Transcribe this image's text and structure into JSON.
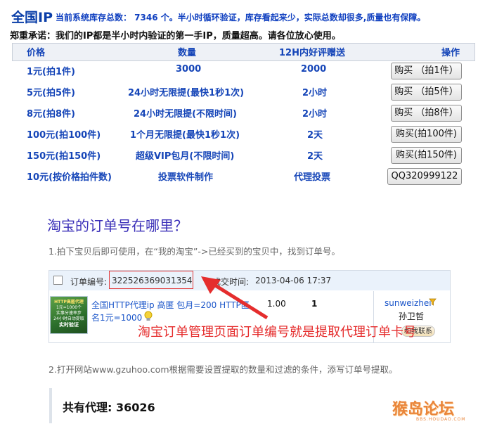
{
  "header": {
    "brand": "全国IP",
    "stock_text": "当前系统库存总数： 7346 个。半小时循环验证，库存看起来少，实际总数却很多,质量也有保障。",
    "promise": "郑重承诺：我们的IP都是半小时内验证的第一手IP，质量超高。请各位放心使用。"
  },
  "price_table": {
    "headers": [
      "价格",
      "数量",
      "12H内好评赠送",
      "操作"
    ],
    "rows": [
      {
        "price": "1元(拍1件)",
        "quantity": "3000",
        "bonus": "2000",
        "action": "购买  （拍1件）"
      },
      {
        "price": "5元(拍5件)",
        "quantity": "24小时无限提(最快1秒1次)",
        "bonus": "2小时",
        "action": "购买  （拍5件）"
      },
      {
        "price": "8元(拍8件)",
        "quantity": "24小时无限提(不限时间)",
        "bonus": "2小时",
        "action": "购买  （拍8件）"
      },
      {
        "price": "100元(拍100件)",
        "quantity": "1个月无限提(最快1秒1次)",
        "bonus": "2天",
        "action": "购买(拍100件)"
      },
      {
        "price": "150元(拍150件)",
        "quantity": "超级VIP包月(不限时间)",
        "bonus": "2天",
        "action": "购买(拍150件)"
      },
      {
        "price": "10元(按价格拍件数)",
        "quantity": "投票软件制作",
        "bonus": "代理投票",
        "action": "QQ320999122"
      }
    ]
  },
  "article": {
    "title": "淘宝的订单号在哪里？",
    "step1": "1.拍下宝贝后即可使用，在“我的淘宝”->已经买到的宝贝中，找到订单号。",
    "step2": "2.打开网站www.gzuhoo.com根据需要设置提取的数量和过滤的条件，添写订单号提取。",
    "proxy_total": "共有代理: 36026"
  },
  "order": {
    "order_label": "订单编号:",
    "order_number": "322526369031354",
    "time_label": "成交时间:",
    "time_value": "2013-04-06 17:37",
    "product_line1": "全国HTTP代理ip 高匿  包月=200 HTTP匿",
    "product_line2": "名1元=1000",
    "price": "1.00",
    "qty": "1",
    "seller": "sunweizhei",
    "seller_name": "孙卫哲",
    "contact": "和我联系",
    "thumb_text": [
      "HTTP高匿代理",
      "1元=1000个",
      "实事分速率步",
      "24小时自动提取",
      "实时验证"
    ],
    "annotation": "淘宝订单管理页面订单编号就是提取代理订单卡号"
  },
  "watermark": {
    "text": "猴岛论坛",
    "sub": "BBS.HOUDAO.COM"
  },
  "colors": {
    "table_text": "#1545b8",
    "title_purple": "#3a2fb8",
    "annotation_red": "#e52d2d",
    "watermark_orange": "#e9853a"
  }
}
